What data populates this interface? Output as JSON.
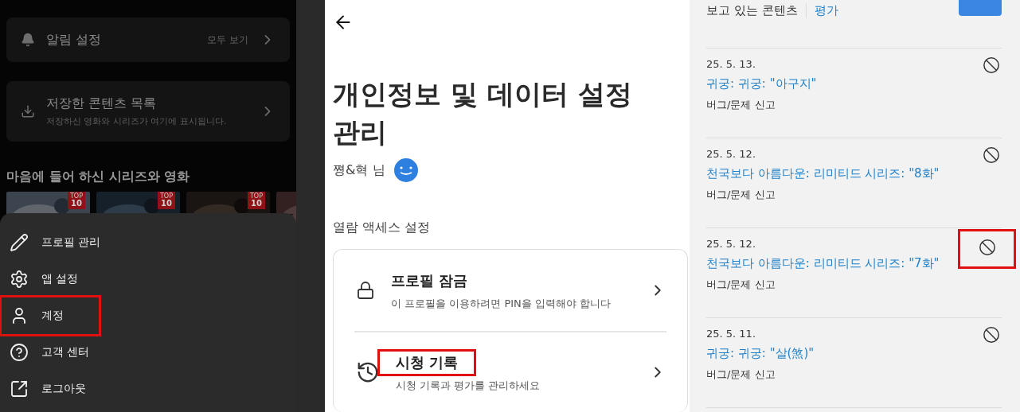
{
  "home_panel": {
    "notification_card": {
      "title": "알림 설정",
      "action": "모두 보기"
    },
    "downloads_card": {
      "title": "저장한 콘텐츠 목록",
      "subtitle": "저장하신 영화와 시리즈가 여기에 표시됩니다."
    },
    "liked_heading": "마음에 들어 하신 시리즈와 영화",
    "thumbnails": [
      {
        "kind": "picture",
        "badge_top": "TOP",
        "badge_number": "10"
      },
      {
        "kind": "picture",
        "badge_top": "TOP",
        "badge_number": "10"
      },
      {
        "kind": "picture",
        "badge_top": "TOP",
        "badge_number": "10"
      },
      {
        "kind": "picture"
      }
    ],
    "menu": [
      {
        "kind": "edit",
        "label": "프로필 관리",
        "highlighted": false
      },
      {
        "kind": "settings",
        "label": "앱 설정",
        "highlighted": false
      },
      {
        "kind": "account",
        "label": "계정",
        "highlighted": true
      },
      {
        "kind": "help",
        "label": "고객 센터",
        "highlighted": false
      },
      {
        "kind": "logout",
        "label": "로그아웃",
        "highlighted": false
      }
    ]
  },
  "privacy_panel": {
    "title": "개인정보 및 데이터 설정 관리",
    "profile_name": "쪙&혁 님",
    "section": "열람 액세스 설정",
    "options": [
      {
        "kind": "lock",
        "title": "프로필 잠금",
        "subtitle": "이 프로필을 이용하려면 PIN을 입력해야 합니다",
        "highlighted": false
      },
      {
        "kind": "history",
        "title": "시청 기록",
        "subtitle": "시청 기록과 평가를 관리하세요",
        "highlighted": true
      }
    ]
  },
  "history_panel": {
    "tabs": [
      {
        "label": "보고 있는 콘텐츠",
        "selected": true
      },
      {
        "label": "평가",
        "selected": false
      }
    ],
    "rows": [
      {
        "date": "25. 5. 13.",
        "title": "귀궁: 귀궁: \"아구지\"",
        "report": "버그/문제 신고",
        "highlighted": false
      },
      {
        "date": "25. 5. 12.",
        "title": "천국보다 아름다운: 리미티드 시리즈: \"8화\"",
        "report": "버그/문제 신고",
        "highlighted": false
      },
      {
        "date": "25. 5. 12.",
        "title": "천국보다 아름다운: 리미티드 시리즈: \"7화\"",
        "report": "버그/문제 신고",
        "highlighted": true
      },
      {
        "date": "25. 5. 11.",
        "title": "귀궁: 귀궁: \"살(煞)\"",
        "report": "버그/문제 신고",
        "highlighted": false
      }
    ]
  }
}
